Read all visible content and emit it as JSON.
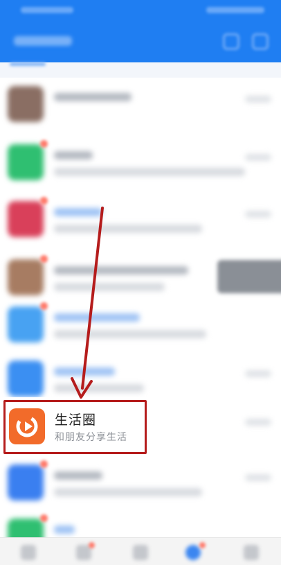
{
  "highlighted_item": {
    "title": "生活圈",
    "subtitle": "和朋友分享生活",
    "icon": "play-circle-icon",
    "icon_color": "#f26b2a"
  },
  "list_items": [
    {
      "avatar_color": "#8a6e63",
      "icon": "person-avatar-icon",
      "badge": false
    },
    {
      "avatar_color": "#2fbf71",
      "icon": "chat-bubble-icon",
      "badge": true
    },
    {
      "avatar_color": "#d9405a",
      "icon": "circle-app-icon",
      "badge": true
    },
    {
      "avatar_color": "#a77c62",
      "icon": "person-avatar-icon",
      "badge": true
    },
    {
      "avatar_color": "#48a2f2",
      "icon": "document-icon",
      "badge": true
    },
    {
      "avatar_color": "#3b8ff2",
      "icon": "pencil-icon",
      "badge": false
    },
    {
      "avatar_color": "#3a7ff0",
      "icon": "grid-app-icon",
      "badge": true
    },
    {
      "avatar_color": "#2fbf71",
      "icon": "chat-bubble-icon",
      "badge": true
    }
  ],
  "colors": {
    "header": "#1f7ef2",
    "highlight_border": "#b51c1c",
    "annotation_arrow": "#b51c1c"
  }
}
